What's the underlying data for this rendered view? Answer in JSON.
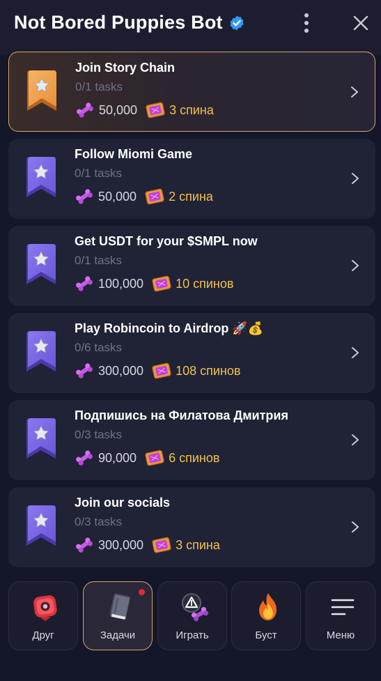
{
  "header": {
    "title": "Not Bored Puppies Bot",
    "verified_icon": "verified-badge-icon",
    "more_icon": "kebab-menu-icon",
    "close_icon": "close-icon"
  },
  "tasks": [
    {
      "title": "Join Story Chain",
      "progress": "0/1 tasks",
      "bones": "50,000",
      "spins": "3 спина",
      "ribbon_color": "#e8903a",
      "active": true
    },
    {
      "title": "Follow Miomi Game",
      "progress": "0/1 tasks",
      "bones": "50,000",
      "spins": "2 спина",
      "ribbon_color": "#6b57d8",
      "active": false
    },
    {
      "title": "Get USDT for your $SMPL now",
      "progress": "0/1 tasks",
      "bones": "100,000",
      "spins": "10 спинов",
      "ribbon_color": "#6b57d8",
      "active": false
    },
    {
      "title": "Play Robincoin to Airdrop 🚀💰",
      "progress": "0/6 tasks",
      "bones": "300,000",
      "spins": "108 спинов",
      "ribbon_color": "#6b57d8",
      "active": false
    },
    {
      "title": "Подпишись на Филатова Дмитрия",
      "progress": "0/3 tasks",
      "bones": "90,000",
      "spins": "6 спинов",
      "ribbon_color": "#6b57d8",
      "active": false
    },
    {
      "title": "Join our socials",
      "progress": "0/3 tasks",
      "bones": "300,000",
      "spins": "3 спина",
      "ribbon_color": "#6b57d8",
      "active": false
    }
  ],
  "bottom_nav": [
    {
      "label": "Друг",
      "icon": "friend-icon",
      "active": false
    },
    {
      "label": "Задачи",
      "icon": "tasks-book-icon",
      "active": true
    },
    {
      "label": "Играть",
      "icon": "play-icon",
      "active": false
    },
    {
      "label": "Буст",
      "icon": "boost-fire-icon",
      "active": false
    },
    {
      "label": "Меню",
      "icon": "menu-icon",
      "active": false
    }
  ],
  "colors": {
    "background": "#14162a",
    "card": "#202235",
    "accent_border": "#d9a46f",
    "spins_text": "#f0c24e",
    "progress_text": "#6f7286",
    "notification_dot": "#e5283c"
  }
}
